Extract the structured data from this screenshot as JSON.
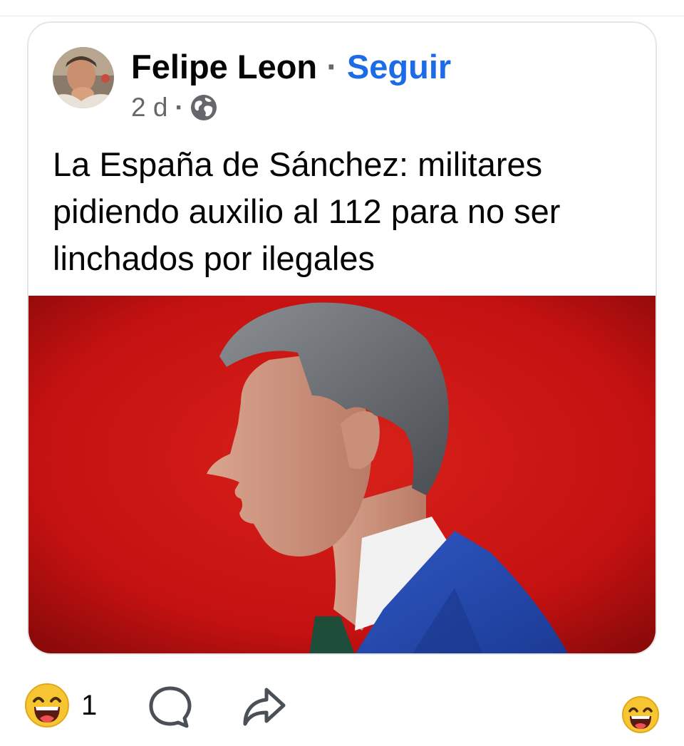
{
  "post": {
    "author_name": "Felipe Leon",
    "separator": "·",
    "follow_label": "Seguir",
    "time_ago": "2 d",
    "meta_separator": "·",
    "audience_icon": "globe-icon",
    "text": "La España de Sánchez: militares pidiendo auxilio al 112 para no ser linchados por ilegales"
  },
  "actions": {
    "reaction_icon": "laughing-emoji",
    "reaction_count": "1",
    "comment_icon": "comment-bubble-icon",
    "share_icon": "share-arrow-icon",
    "react_icon": "laughing-emoji"
  },
  "colors": {
    "follow_link": "#1b6ce5",
    "image_background": "#cc1212",
    "emoji_yellow": "#f7c531"
  }
}
